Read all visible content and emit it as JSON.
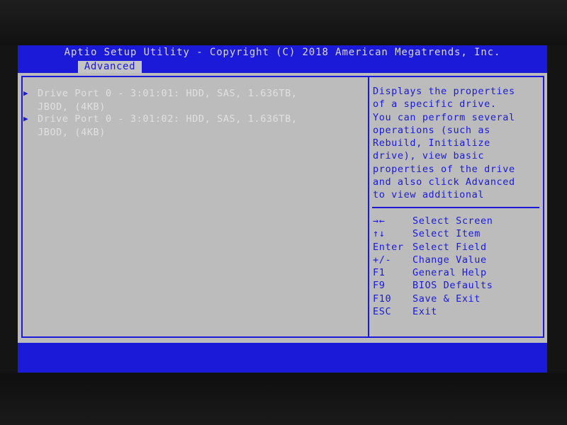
{
  "title": "Aptio Setup Utility - Copyright (C) 2018 American Megatrends, Inc.",
  "active_tab": "Advanced",
  "menu_items": [
    {
      "line1": "Drive Port 0 - 3:01:01: HDD, SAS, 1.636TB,",
      "line2": "JBOD, (4KB)"
    },
    {
      "line1": "Drive Port 0 - 3:01:02: HDD, SAS, 1.636TB,",
      "line2": "JBOD, (4KB)"
    }
  ],
  "help_text": "Displays the properties\nof a specific drive.\nYou can perform several\noperations (such as\nRebuild, Initialize\ndrive), view basic\nproperties of the drive\nand also click Advanced\nto view additional",
  "key_help": [
    {
      "key": "→←",
      "desc": "Select Screen"
    },
    {
      "key": "↑↓",
      "desc": "Select Item"
    },
    {
      "key": "Enter",
      "desc": "Select Field"
    },
    {
      "key": "+/-",
      "desc": "Change Value"
    },
    {
      "key": "F1",
      "desc": "General Help"
    },
    {
      "key": "F9",
      "desc": "BIOS Defaults"
    },
    {
      "key": "F10",
      "desc": "Save & Exit"
    },
    {
      "key": "ESC",
      "desc": "Exit"
    }
  ],
  "colors": {
    "bios_blue": "#1a1ad8",
    "panel_gray": "#bcbcbc",
    "text_light": "#e0e0e0"
  }
}
